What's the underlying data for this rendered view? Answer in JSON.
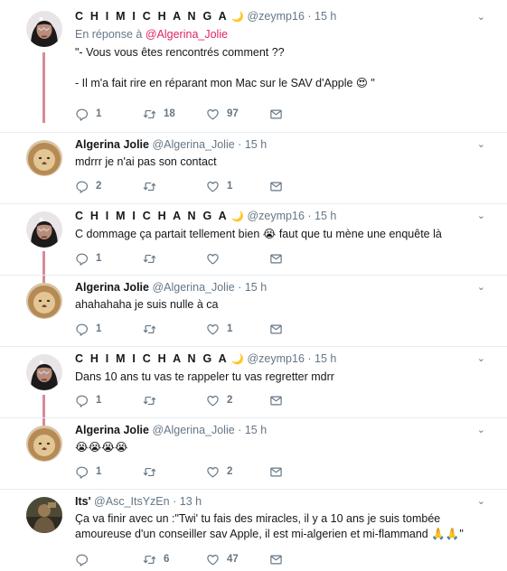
{
  "tweets": [
    {
      "name": "C H I M I C H A N G A",
      "moon": "🌙",
      "handle": "@zeymp16",
      "time": "15 h",
      "reply_prefix": "En réponse à",
      "reply_mention": "@Algerina_Jolie",
      "lines": [
        "\"- Vous vous êtes rencontrés comment ??",
        "",
        "- Il m'a fait rire en réparant mon Mac sur le SAV d'Apple 😍 \""
      ],
      "replies": "1",
      "retweets": "18",
      "likes": "97"
    },
    {
      "name": "Algerina Jolie",
      "handle": "@Algerina_Jolie",
      "time": "15 h",
      "lines": [
        "mdrrr je n'ai pas son contact"
      ],
      "replies": "2",
      "retweets": "",
      "likes": "1"
    },
    {
      "name": "C H I M I C H A N G A",
      "moon": "🌙",
      "handle": "@zeymp16",
      "time": "15 h",
      "lines": [
        "C dommage ça partait tellement bien 😭 faut que tu mène une enquête là"
      ],
      "replies": "1",
      "retweets": "",
      "likes": ""
    },
    {
      "name": "Algerina Jolie",
      "handle": "@Algerina_Jolie",
      "time": "15 h",
      "lines": [
        "ahahahaha je suis nulle à ca"
      ],
      "replies": "1",
      "retweets": "",
      "likes": "1"
    },
    {
      "name": "C H I M I C H A N G A",
      "moon": "🌙",
      "handle": "@zeymp16",
      "time": "15 h",
      "lines": [
        "Dans 10 ans tu vas te rappeler tu vas regretter mdrr"
      ],
      "replies": "1",
      "retweets": "",
      "likes": "2"
    },
    {
      "name": "Algerina Jolie",
      "handle": "@Algerina_Jolie",
      "time": "15 h",
      "lines": [
        "😭😭😭😭"
      ],
      "replies": "1",
      "retweets": "",
      "likes": "2"
    },
    {
      "name": "Its'",
      "handle": "@Asc_ItsYzEn",
      "time": "13 h",
      "lines": [
        "Ça va finir avec un :\"Twi' tu fais des miracles, il y a 10 ans je suis tombée",
        "amoureuse d'un conseiller sav Apple, il est mi-algerien et mi-flammand 🙏🙏\""
      ],
      "replies": "",
      "retweets": "6",
      "likes": "47"
    }
  ],
  "colors": {
    "thread_line": "#d88a97",
    "mention": "#e0245e",
    "meta": "#657786",
    "divider": "#e6ecf0"
  },
  "icons": {
    "reply": "reply-icon",
    "retweet": "retweet-icon",
    "like": "heart-icon",
    "dm": "message-icon",
    "menu": "chevron-down-icon"
  }
}
